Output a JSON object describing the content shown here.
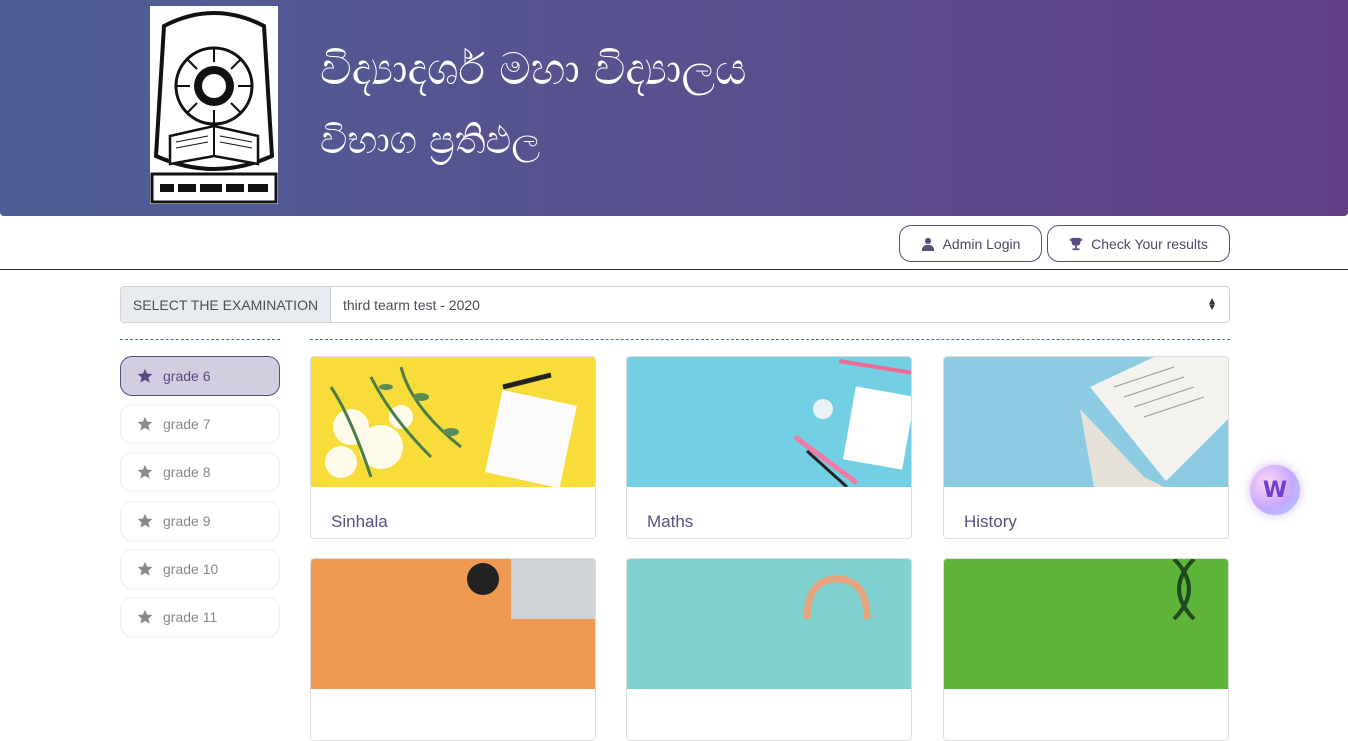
{
  "header": {
    "school_name": "විද්‍යාදශර් මහා විද්‍යාලය",
    "subtitle": "විභාග ප්‍රතිඵල",
    "logo_icon": "school-crest-icon"
  },
  "nav": {
    "admin_login": "Admin Login",
    "check_results": "Check Your results",
    "admin_icon": "user-icon",
    "check_icon": "trophy-icon"
  },
  "exam": {
    "label": "SELECT THE EXAMINATION",
    "selected": "third tearm test - 2020"
  },
  "grades": [
    {
      "label": "grade 6",
      "active": true
    },
    {
      "label": "grade 7",
      "active": false
    },
    {
      "label": "grade 8",
      "active": false
    },
    {
      "label": "grade 9",
      "active": false
    },
    {
      "label": "grade 10",
      "active": false
    },
    {
      "label": "grade 11",
      "active": false
    }
  ],
  "subjects": [
    {
      "name": "Sinhala"
    },
    {
      "name": "Maths"
    },
    {
      "name": "History"
    },
    {
      "name": ""
    },
    {
      "name": ""
    },
    {
      "name": ""
    }
  ],
  "colors": {
    "accent": "#5b4a80",
    "banner_start": "#4e5f97",
    "banner_end": "#623f85"
  }
}
